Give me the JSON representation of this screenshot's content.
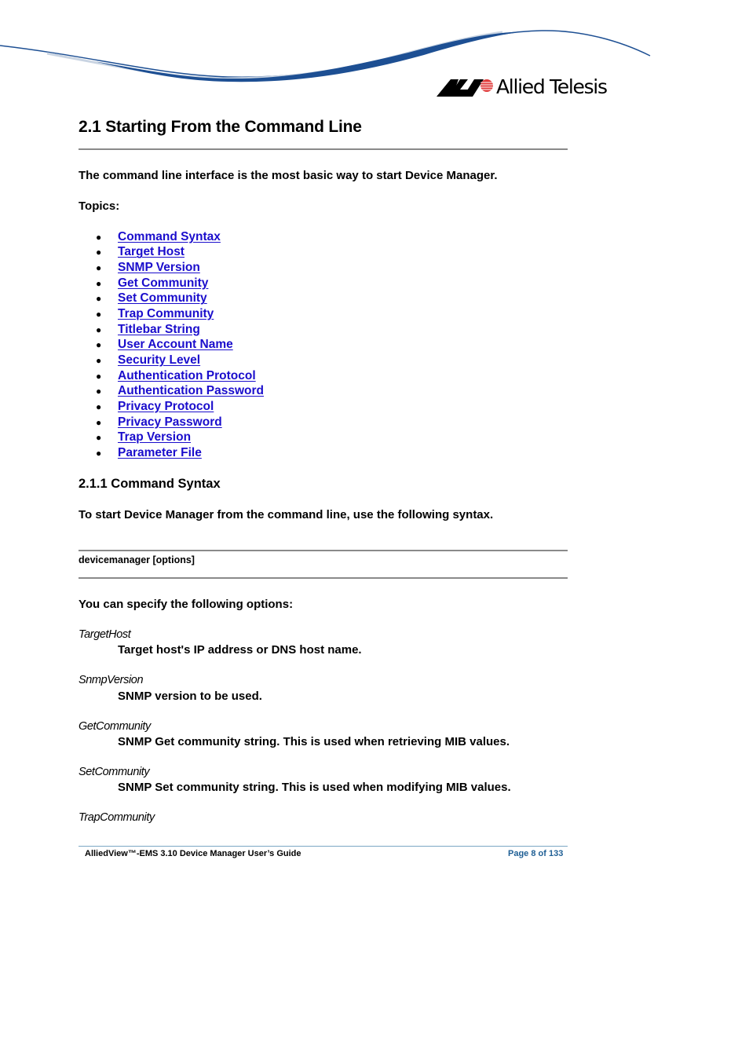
{
  "header": {
    "brand": "Allied Telesis",
    "colors": {
      "swoosh_blue": "#1d4f93",
      "swoosh_light": "#c9d4e2",
      "logo_red": "#e03b3b"
    }
  },
  "section": {
    "title": "2.1 Starting From the Command Line",
    "intro": "The command line interface is the most basic way to start Device Manager.",
    "topics_label": "Topics:",
    "topics": [
      "Command Syntax",
      "Target Host",
      "SNMP Version",
      "Get Community",
      "Set Community",
      "Trap Community",
      "Titlebar String",
      "User Account Name",
      "Security Level",
      "Authentication Protocol",
      "Authentication Password",
      "Privacy Protocol",
      "Privacy Password",
      "Trap Version",
      "Parameter File"
    ],
    "link_color": "#1a0dcc"
  },
  "subsection": {
    "title": "2.1.1 Command Syntax",
    "intro": "To start Device Manager from the command line, use the following syntax.",
    "syntax": "devicemanager [options]",
    "options_intro": "You can specify the following options:",
    "options": [
      {
        "name": "TargetHost",
        "desc": "Target host's IP address or DNS host name."
      },
      {
        "name": "SnmpVersion",
        "desc": "SNMP version to be used."
      },
      {
        "name": "GetCommunity",
        "desc": "SNMP Get community string. This is used when retrieving MIB values."
      },
      {
        "name": "SetCommunity",
        "desc": "SNMP Set community string. This is used when modifying MIB values."
      },
      {
        "name": "TrapCommunity",
        "desc": ""
      }
    ]
  },
  "footer": {
    "doc_title": "AlliedView™-EMS 3.10 Device Manager User’s Guide",
    "page": "Page 8 of 133"
  }
}
